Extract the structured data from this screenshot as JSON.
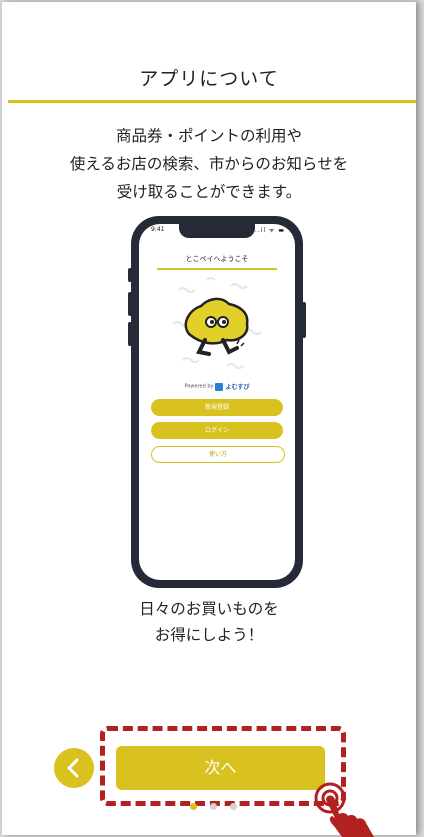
{
  "header": {
    "title": "アプリについて"
  },
  "description": {
    "lines": [
      "商品券・ポイントの利用や",
      "使えるお店の検索、市からのお知らせを",
      "受け取ることができます。"
    ]
  },
  "phone": {
    "status_time": "9:41",
    "status_icons": "..il ᯤ ▬",
    "welcome": "とこペイへようこそ",
    "powered_by_text": "Powered by",
    "powered_by_brand": "よむすび",
    "register_label": "新規登録",
    "login_label": "ログイン",
    "howto_label": "使い方"
  },
  "tagline": {
    "lines": [
      "日々のお買いものを",
      "お得にしよう！"
    ]
  },
  "navigation": {
    "back_icon": "chevron-left-icon",
    "next_label": "次へ",
    "page_count": 3,
    "current_page": 1
  },
  "colors": {
    "accent": "#d9c21f",
    "highlight": "#b0211f",
    "phone_frame": "#262a36",
    "dot_inactive": "#d3d3d3"
  }
}
